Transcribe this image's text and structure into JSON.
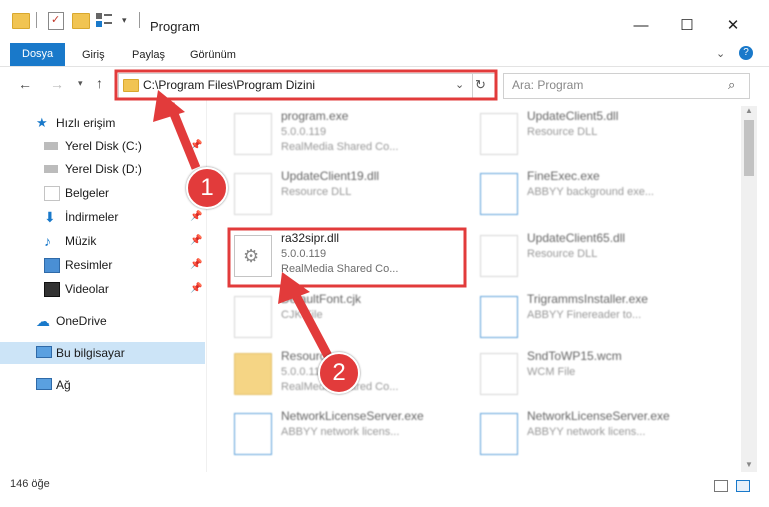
{
  "window": {
    "title": "Program",
    "minimize": "—",
    "maximize": "☐",
    "close": "✕"
  },
  "ribbon": {
    "tabs": [
      "Dosya",
      "Giriş",
      "Paylaş",
      "Görünüm"
    ],
    "help": "?"
  },
  "address": {
    "path": "C:\\Program Files\\Program Dizini"
  },
  "search": {
    "placeholder": "Ara: Program"
  },
  "nav": {
    "items": [
      {
        "label": "Hızlı erişim",
        "icon": "star-icon",
        "pinned": false
      },
      {
        "label": "Yerel Disk (C:)",
        "icon": "drive-icon",
        "pinned": true
      },
      {
        "label": "Yerel Disk (D:)",
        "icon": "drive-icon",
        "pinned": false
      },
      {
        "label": "Belgeler",
        "icon": "documents-icon",
        "pinned": true
      },
      {
        "label": "İndirmeler",
        "icon": "download-icon",
        "pinned": true
      },
      {
        "label": "Müzik",
        "icon": "music-icon",
        "pinned": true
      },
      {
        "label": "Resimler",
        "icon": "pictures-icon",
        "pinned": true
      },
      {
        "label": "Videolar",
        "icon": "videos-icon",
        "pinned": true
      },
      {
        "label": "OneDrive",
        "icon": "cloud-icon",
        "pinned": false
      },
      {
        "label": "Bu bilgisayar",
        "icon": "computer-icon",
        "pinned": false
      },
      {
        "label": "Ağ",
        "icon": "network-icon",
        "pinned": false
      }
    ]
  },
  "files": {
    "left": [
      {
        "name": "program.exe",
        "version": "5.0.0.119",
        "desc": "RealMedia Shared Co..."
      },
      {
        "name": "UpdateClient19.dll",
        "version": "",
        "desc": "Resource DLL"
      },
      {
        "name": "ra32sipr.dll",
        "version": "5.0.0.119",
        "desc": "RealMedia Shared Co..."
      },
      {
        "name": "DefaultFont.cjk",
        "version": "",
        "desc": "CJK File"
      },
      {
        "name": "Resources",
        "version": "5.0.0.119",
        "desc": "RealMedia Shared Co..."
      },
      {
        "name": "NetworkLicenseServer.exe",
        "version": "",
        "desc": "ABBYY network licens..."
      }
    ],
    "right": [
      {
        "name": "UpdateClient5.dll",
        "version": "",
        "desc": "Resource DLL"
      },
      {
        "name": "FineExec.exe",
        "version": "",
        "desc": "ABBYY background exe..."
      },
      {
        "name": "UpdateClient65.dll",
        "version": "",
        "desc": "Resource DLL"
      },
      {
        "name": "TrigrammsInstaller.exe",
        "version": "",
        "desc": "ABBYY Finereader to..."
      },
      {
        "name": "SndToWP15.wcm",
        "version": "",
        "desc": "WCM File"
      },
      {
        "name": "NetworkLicenseServer.exe",
        "version": "",
        "desc": "ABBYY network licens..."
      }
    ]
  },
  "status": {
    "count": "146 öğe"
  },
  "annotations": {
    "step1": "1",
    "step2": "2",
    "color": "#e23b3b"
  }
}
